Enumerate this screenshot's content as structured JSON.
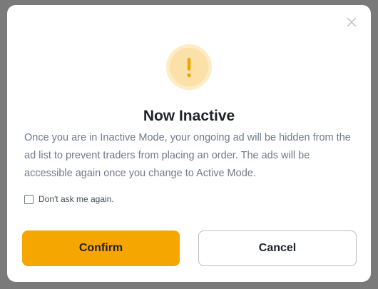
{
  "dialog": {
    "title": "Now Inactive",
    "message": "Once you are in Inactive Mode, your ongoing ad will be hidden from the ad list to prevent traders from placing an order. The ads will be accessible again once you change to Active Mode.",
    "checkbox_label": "Don't ask me again.",
    "checkbox_checked": false,
    "confirm_label": "Confirm",
    "cancel_label": "Cancel",
    "icons": {
      "close": "close-icon",
      "warning": "exclamation-icon"
    },
    "colors": {
      "accent": "#f6a600",
      "warning_ring": "#fdecc6",
      "warning_fill": "#fbe0a8",
      "title": "#1e2329",
      "body": "#707a8a"
    }
  }
}
